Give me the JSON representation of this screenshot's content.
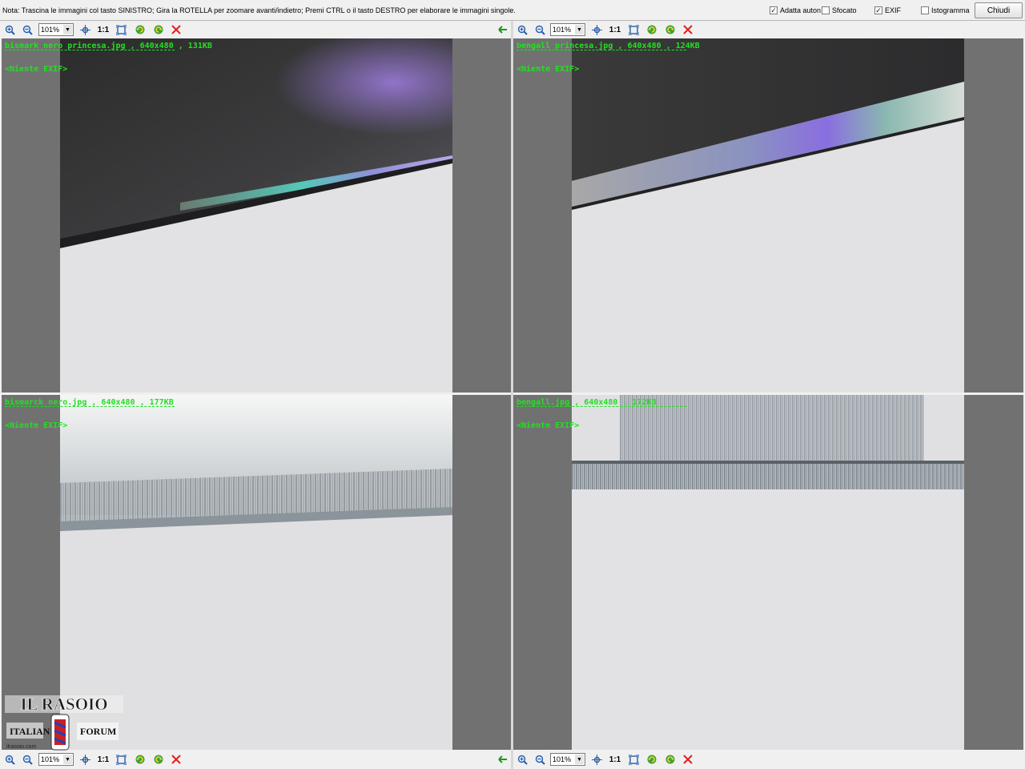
{
  "top": {
    "note": "Nota: Trascina le immagini col tasto SINISTRO; Gira la ROTELLA per zoomare avanti/indietro; Premi CTRL o il tasto DESTRO per elaborare le immagini singole.",
    "options": [
      {
        "label": "Adatta auton",
        "checked": true
      },
      {
        "label": "Sfocato",
        "checked": false
      },
      {
        "label": "EXIF",
        "checked": true
      },
      {
        "label": "Istogramma",
        "checked": false
      }
    ],
    "close_label": "Chiudi"
  },
  "toolbar": {
    "zoom_value": "101%",
    "one_to_one": "1:1"
  },
  "panes": [
    {
      "filename": "bismark nero princesa.jpg",
      "dims": "640x480",
      "size": "131KB",
      "exif": "<Niente EXIF>"
    },
    {
      "filename": "bengall princesa.jpg",
      "dims": "640x480",
      "size": "124KB",
      "exif": "<Niente EXIF>"
    },
    {
      "filename": "bismarck nero.jpg",
      "dims": "640x480",
      "size": "177KB",
      "exif": "<Niente EXIF>"
    },
    {
      "filename": "bengall.jpg",
      "dims": "640x480",
      "size": "172KB",
      "exif": "<Niente EXIF>"
    }
  ],
  "watermark": {
    "title": "IL RASOIO",
    "left_word": "ITALIAN",
    "right_word": "FORUM",
    "site": "ilrasoio.com"
  },
  "colors": {
    "info_text": "#22e022",
    "pane_bg": "#717171",
    "delete_icon": "#e02020"
  }
}
